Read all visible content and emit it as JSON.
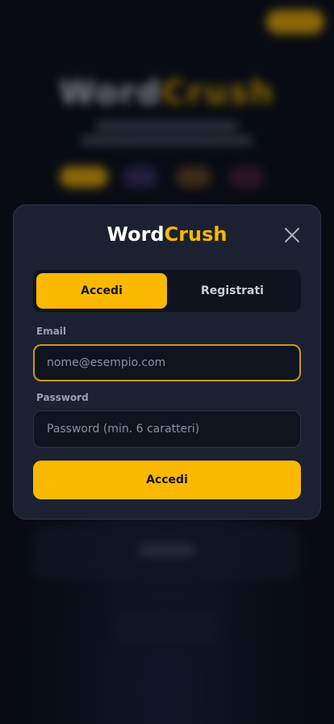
{
  "modal": {
    "title_part1": "Word",
    "title_part2": "Crush",
    "close_icon": "close-icon",
    "tabs": [
      {
        "label": "Accedi",
        "active": true
      },
      {
        "label": "Registrati",
        "active": false
      }
    ],
    "email": {
      "label": "Email",
      "placeholder": "nome@esempio.com",
      "value": ""
    },
    "password": {
      "label": "Password",
      "placeholder": "Password (min. 6 caratteri)",
      "value": ""
    },
    "submit_label": "Accedi"
  },
  "colors": {
    "accent": "#fbb800",
    "modal_bg": "#1b2130",
    "page_bg": "#080b12",
    "focus_border": "#c79a1a"
  }
}
